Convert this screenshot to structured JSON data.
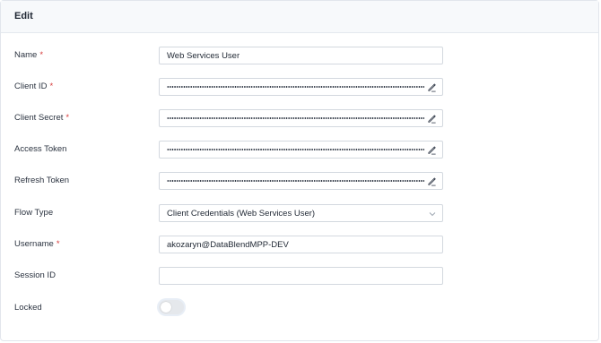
{
  "panel": {
    "title": "Edit"
  },
  "fields": {
    "name": {
      "label": "Name",
      "required_mark": "*",
      "value": "Web Services User"
    },
    "client_id": {
      "label": "Client ID",
      "required_mark": "*",
      "masked": true
    },
    "client_secret": {
      "label": "Client Secret",
      "required_mark": "*",
      "masked": true
    },
    "access_token": {
      "label": "Access Token",
      "masked": true
    },
    "refresh_token": {
      "label": "Refresh Token",
      "masked": true
    },
    "flow_type": {
      "label": "Flow Type",
      "value": "Client Credentials (Web Services User)"
    },
    "username": {
      "label": "Username",
      "required_mark": "*",
      "value": "akozaryn@DataBlendMPP-DEV"
    },
    "session_id": {
      "label": "Session ID",
      "value": ""
    },
    "locked": {
      "label": "Locked",
      "checked": false
    }
  },
  "icons": {
    "edit": "pencil-icon",
    "dropdown": "chevron-down-icon"
  },
  "colors": {
    "required": "#d63a3a",
    "header_bg": "#f7f9fb",
    "border": "#d3d8df",
    "toggle_off": "#e5e8ec"
  }
}
